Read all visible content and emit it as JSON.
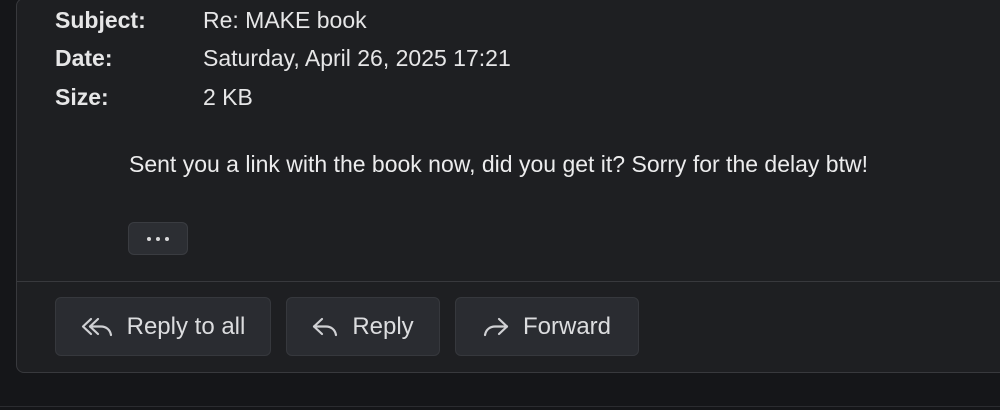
{
  "header": {
    "subject_label": "Subject:",
    "subject_value": "Re: MAKE book",
    "date_label": "Date:",
    "date_value": "Saturday, April 26, 2025 17:21",
    "size_label": "Size:",
    "size_value": "2 KB"
  },
  "message": {
    "body": "Sent you a link with the book now, did you get it? Sorry for the delay btw!"
  },
  "more_button": {
    "icon": "ellipsis-icon"
  },
  "actions": {
    "reply_all_label": "Reply to all",
    "reply_all_icon": "reply-all-icon",
    "reply_label": "Reply",
    "reply_icon": "reply-icon",
    "forward_label": "Forward",
    "forward_icon": "forward-icon"
  },
  "colors": {
    "background": "#151619",
    "panel": "#1e1f22",
    "button": "#2a2c31",
    "text": "#e9e9ea"
  }
}
